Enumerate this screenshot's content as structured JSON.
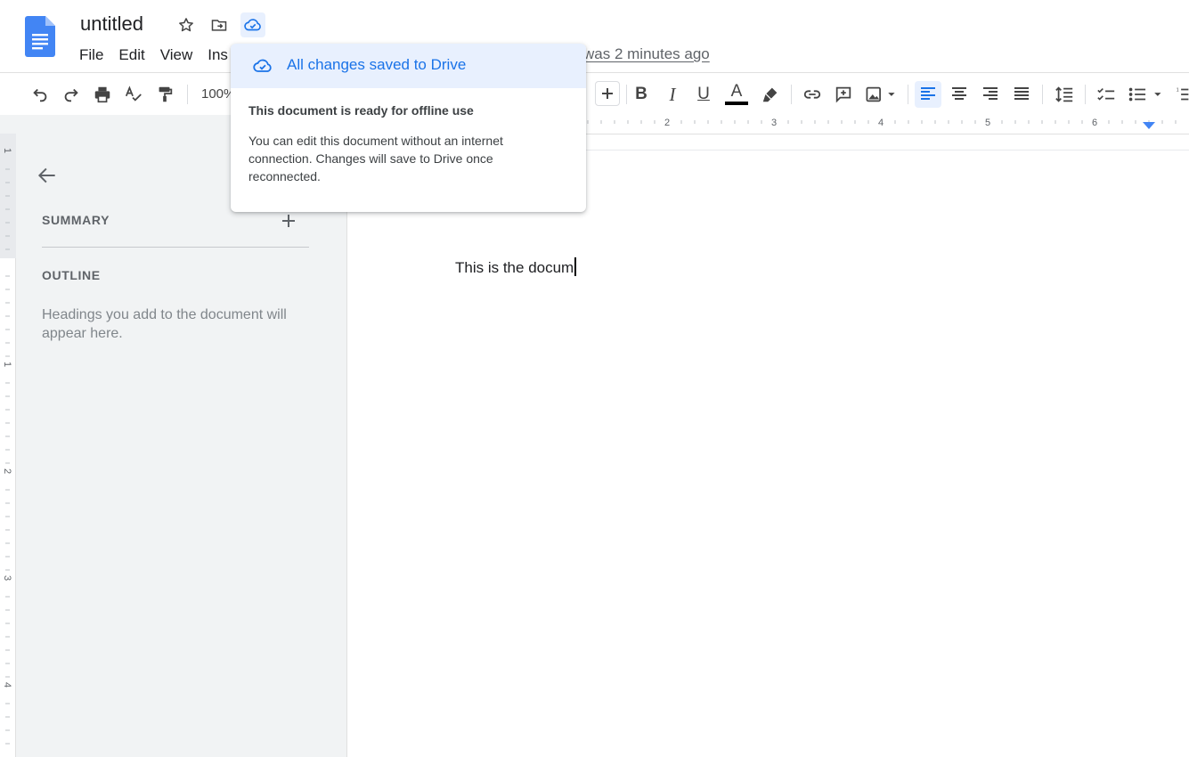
{
  "document": {
    "title": "untitled",
    "body_text": "This is the docum"
  },
  "menu": [
    "File",
    "Edit",
    "View",
    "Ins"
  ],
  "last_edit": "was 2 minutes ago",
  "toolbar": {
    "zoom": "100%",
    "bold": "B",
    "italic": "I",
    "underline": "U",
    "text_color": "A"
  },
  "popup": {
    "header": "All changes saved to Drive",
    "title": "This document is ready for offline use",
    "body": "You can edit this document without an internet connection. Changes will save to Drive once reconnected."
  },
  "sidebar": {
    "summary_label": "SUMMARY",
    "outline_label": "OUTLINE",
    "outline_help": "Headings you add to the document will appear here."
  },
  "ruler": {
    "h_ticks": [
      "2",
      "3",
      "4",
      "5",
      "6"
    ],
    "v_ticks": [
      "1",
      "1",
      "2",
      "3",
      "4"
    ]
  },
  "colors": {
    "accent": "#1a73e8",
    "selected_bg": "#e8f0fe",
    "sidebar_bg": "#f1f3f4"
  },
  "icons": [
    "docs-logo",
    "star-icon",
    "move-to-folder-icon",
    "cloud-saved-icon",
    "undo-icon",
    "redo-icon",
    "print-icon",
    "spellcheck-icon",
    "paint-format-icon",
    "plus-icon",
    "highlight-icon",
    "link-icon",
    "add-comment-icon",
    "insert-image-icon",
    "align-left-icon",
    "align-center-icon",
    "align-right-icon",
    "justify-icon",
    "line-spacing-icon",
    "checklist-icon",
    "bulleted-list-icon",
    "back-arrow-icon"
  ]
}
